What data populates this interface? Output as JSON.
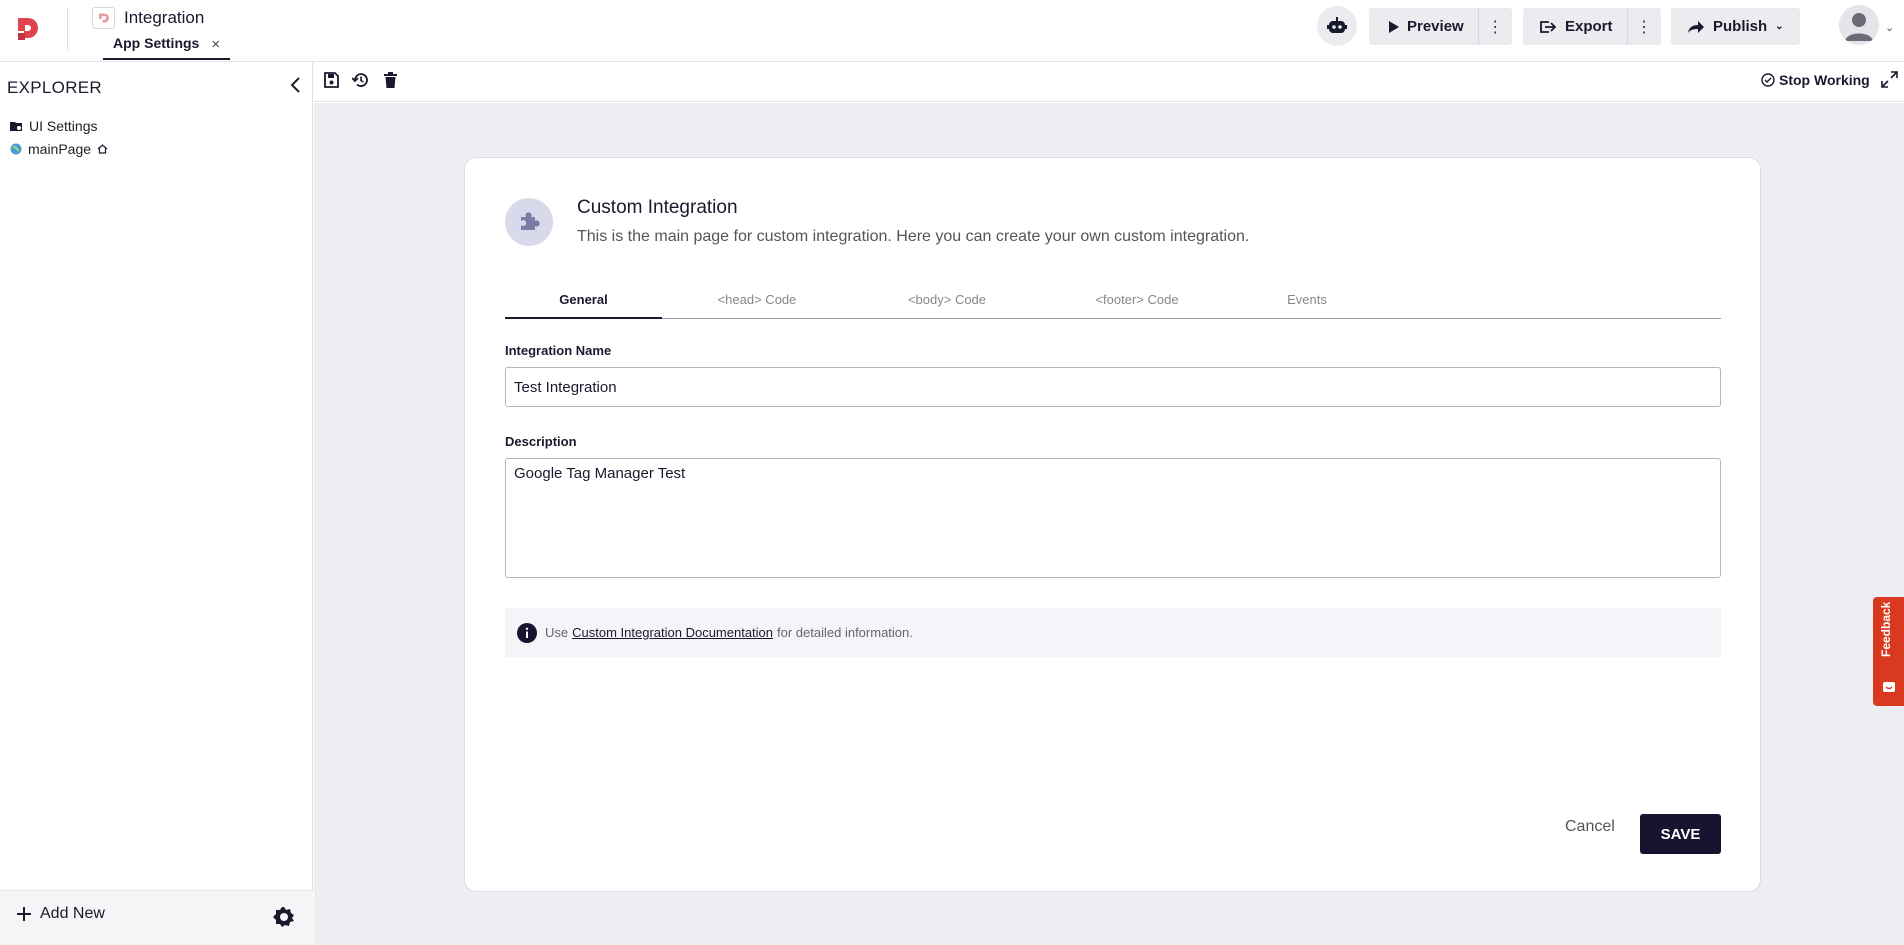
{
  "header": {
    "app_title": "Integration",
    "open_tab": "App Settings",
    "tab_close": "×",
    "preview_label": "Preview",
    "export_label": "Export",
    "publish_label": "Publish",
    "more_glyph": "⋮"
  },
  "sidebar": {
    "title": "EXPLORER",
    "items": [
      {
        "label": "UI Settings",
        "icon": "folder-settings-icon"
      },
      {
        "label": "mainPage",
        "icon": "globe-icon",
        "badge_icon": "home-icon"
      }
    ],
    "add_new_label": "Add New"
  },
  "toolbar": {
    "stop_working_label": "Stop Working"
  },
  "card": {
    "title": "Custom Integration",
    "subtitle": "This is the main page for custom integration. Here you can create your own custom integration.",
    "tabs": [
      {
        "label": "General",
        "active": true
      },
      {
        "label": "<head> Code",
        "active": false
      },
      {
        "label": "<body> Code",
        "active": false
      },
      {
        "label": "<footer> Code",
        "active": false
      },
      {
        "label": "Events",
        "active": false
      }
    ],
    "name_label": "Integration Name",
    "name_value": "Test Integration",
    "description_label": "Description",
    "description_value": "Google Tag Manager Test",
    "info_prefix": "Use",
    "info_link": "Custom Integration Documentation",
    "info_suffix": "for detailed information.",
    "cancel_label": "Cancel",
    "save_label": "SAVE"
  },
  "feedback_label": "Feedback",
  "colors": {
    "accent_dark": "#16142e",
    "brand_red": "#e0454f",
    "feedback_red": "#d8391f",
    "canvas_bg": "#eceef1"
  }
}
